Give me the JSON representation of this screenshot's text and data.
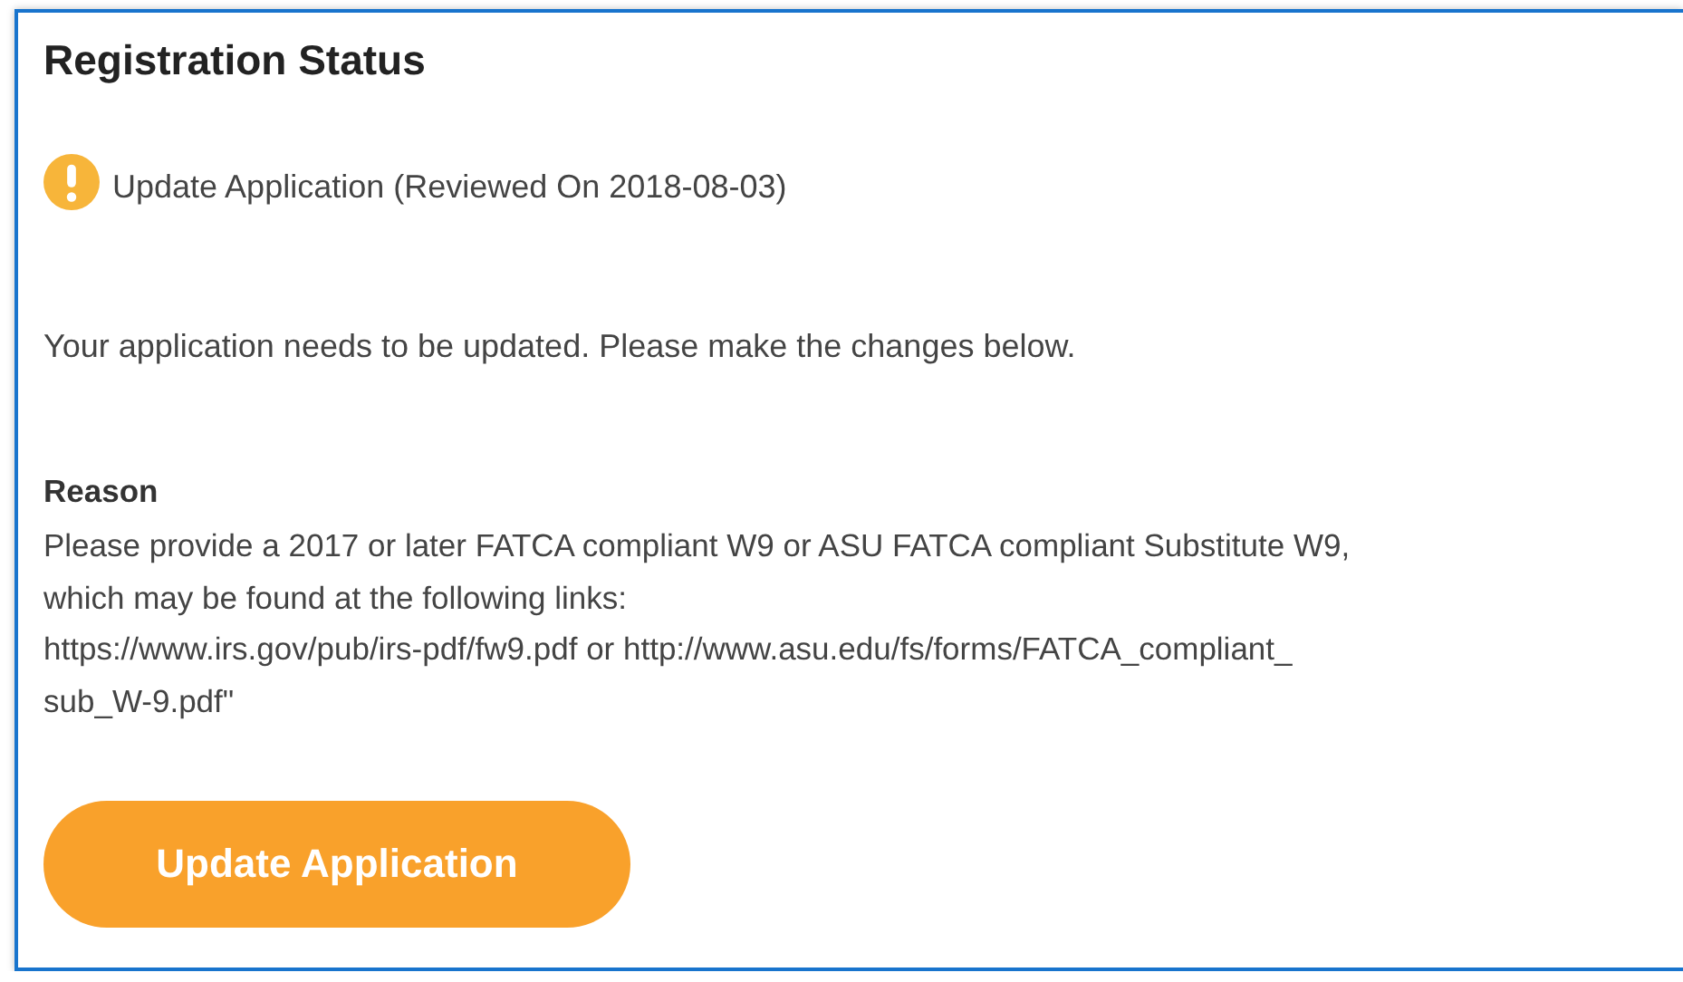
{
  "title": "Registration Status",
  "status": {
    "kind": "warning",
    "text": "Update Application (Reviewed On 2018-08-03)"
  },
  "message": "Your application needs to be updated. Please make the changes below.",
  "reason": {
    "label": "Reason",
    "lines": [
      "Please provide a 2017 or later FATCA compliant W9 or ASU FATCA compliant Substitute W9,",
      "which may be found at the following links:",
      "https://www.irs.gov/pub/irs-pdf/fw9.pdf or http://www.asu.edu/fs/forms/FATCA_compliant_",
      "sub_W-9.pdf\""
    ]
  },
  "button": "Update Application"
}
